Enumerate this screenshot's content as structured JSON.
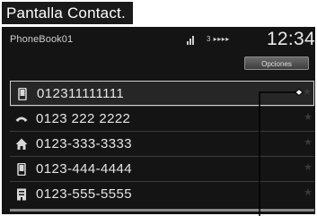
{
  "caption": "Pantalla Contact.",
  "status": {
    "title": "PhoneBook01",
    "mid": "3 ▸▸▸▸",
    "clock": "12:34"
  },
  "options_label": "Opciones",
  "entries": [
    {
      "icon": "mobile-phone-icon",
      "number": "012311111111",
      "selected": true
    },
    {
      "icon": "landline-phone-icon",
      "number": "0123 222 2222",
      "selected": false
    },
    {
      "icon": "home-icon",
      "number": "0123-333-3333",
      "selected": false
    },
    {
      "icon": "mobile-phone-icon",
      "number": "0123-444-4444",
      "selected": false
    },
    {
      "icon": "work-building-icon",
      "number": "0123-555-5555",
      "selected": false
    }
  ],
  "colors": {
    "screen_bg": "#141414",
    "text": "#e6e6e6",
    "selected_border": "#cfcfcf",
    "caption_bg": "#1a1a1a"
  }
}
